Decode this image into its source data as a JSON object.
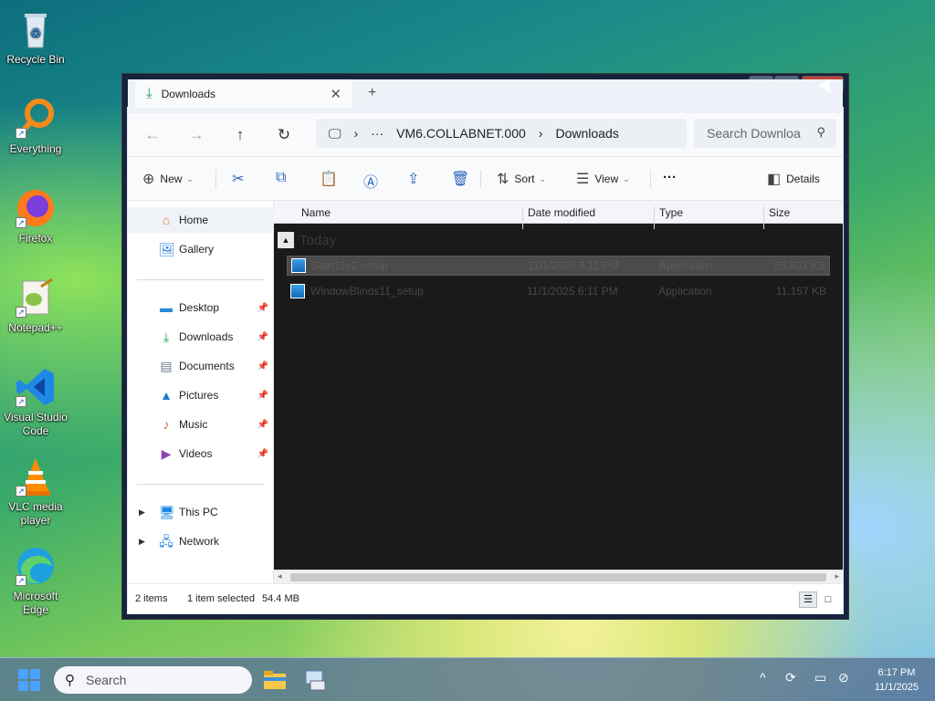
{
  "desktop": {
    "icons": [
      {
        "label": "Recycle Bin",
        "icon": "recycle-bin-icon"
      },
      {
        "label": "Everything",
        "icon": "everything-search-icon"
      },
      {
        "label": "Firefox",
        "icon": "firefox-icon"
      },
      {
        "label": "Notepad++",
        "icon": "notepad-plus-plus-icon"
      },
      {
        "label": "Visual Studio Code",
        "icon": "vscode-icon"
      },
      {
        "label": "VLC media player",
        "icon": "vlc-icon"
      },
      {
        "label": "Microsoft Edge",
        "icon": "edge-icon"
      }
    ]
  },
  "window": {
    "tab_label": "Downloads",
    "tab_close": "✕",
    "new_tab": "+",
    "controls": {
      "minimize": "—",
      "maximize": "□",
      "close": "✕"
    }
  },
  "addressbar": {
    "back": "←",
    "forward": "→",
    "up": "↑",
    "refresh": "↻",
    "crumbs": [
      "VM6.COLLABNET.000",
      "Downloads"
    ],
    "ellipsis": "···",
    "search_placeholder": "Search Downloa"
  },
  "toolbar": {
    "new_label": "New",
    "sort_label": "Sort",
    "view_label": "View",
    "more_label": "···",
    "details_label": "Details"
  },
  "sidebar": {
    "home": "Home",
    "gallery": "Gallery",
    "pinned": [
      "Desktop",
      "Downloads",
      "Documents",
      "Pictures",
      "Music",
      "Videos"
    ],
    "this_pc": "This PC",
    "network": "Network"
  },
  "columns": {
    "name": "Name",
    "date": "Date modified",
    "type": "Type",
    "size": "Size"
  },
  "group_label": "Today",
  "files": [
    {
      "name": "Start11v2-setup",
      "date": "11/1/2025 6:11 PM",
      "type": "Application",
      "size": "55,801 KB",
      "selected": true
    },
    {
      "name": "WindowBlinds11_setup",
      "date": "11/1/2025 6:11 PM",
      "type": "Application",
      "size": "11,157 KB",
      "selected": false
    }
  ],
  "status": {
    "count": "2 items",
    "selection": "1 item selected",
    "size": "54.4 MB"
  },
  "taskbar": {
    "search_placeholder": "Search",
    "time": "6:17 PM",
    "date": "11/1/2025",
    "tray_chevron": "^"
  },
  "colors": {
    "accent": "#2b63b8",
    "window_frame": "#16233b",
    "content_bg": "#1a1a1a"
  }
}
